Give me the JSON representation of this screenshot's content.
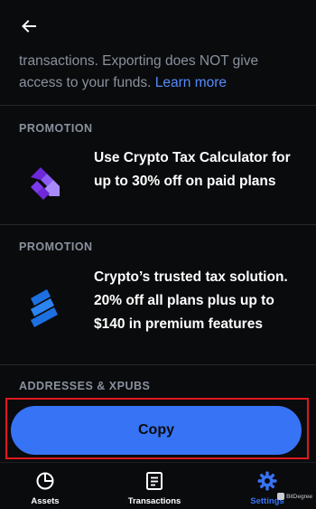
{
  "intro": {
    "line1": "transactions. Exporting does NOT give",
    "line2_prefix": "access to your funds. ",
    "learn_more": "Learn more"
  },
  "promotions": [
    {
      "label": "PROMOTION",
      "text": "Use Crypto Tax Calculator for up to 30% off on paid plans",
      "icon": "crypto-tax-calculator-logo",
      "icon_color": "#7b3ff2"
    },
    {
      "label": "PROMOTION",
      "text": "Crypto’s trusted tax solution. 20% off all plans plus up to $140 in premium features",
      "icon": "tax-solution-logo",
      "icon_color": "#1f6fde"
    }
  ],
  "addresses": {
    "label": "ADDRESSES & XPUBS",
    "copy_label": "Copy"
  },
  "bottom_nav": [
    {
      "label": "Assets",
      "icon": "pie-chart-icon",
      "active": false
    },
    {
      "label": "Transactions",
      "icon": "document-list-icon",
      "active": false
    },
    {
      "label": "Settings",
      "icon": "gear-icon",
      "active": true
    }
  ],
  "watermark": "BitDegree",
  "colors": {
    "background": "#0a0b0d",
    "accent": "#3773f5",
    "link": "#578bfa",
    "muted_text": "#8a919e",
    "highlight_border": "#e0181e"
  }
}
